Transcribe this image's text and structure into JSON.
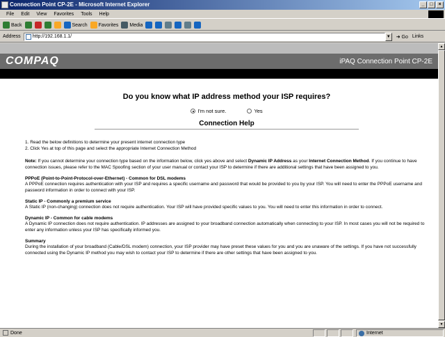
{
  "window": {
    "title": "Connection Point CP-2E - Microsoft Internet Explorer"
  },
  "menu": [
    "File",
    "Edit",
    "View",
    "Favorites",
    "Tools",
    "Help"
  ],
  "toolbar": {
    "back": "Back",
    "search": "Search",
    "favorites": "Favorites",
    "media": "Media"
  },
  "address": {
    "label": "Address",
    "url": "http://192.168.1.1/",
    "go": "Go",
    "links": "Links"
  },
  "banner": {
    "brand": "COMPAQ",
    "product": "iPAQ Connection Point CP-2E"
  },
  "page": {
    "question": "Do you know what IP address method your ISP requires?",
    "radio_not_sure": "I'm not sure.",
    "radio_yes": "Yes",
    "help_title": "Connection Help",
    "step1": "1. Read the below definitions to determine your present internet connection type",
    "step2": "2. Click Yes at top of this page and select the appropriate Internet Connection Method",
    "note_label": "Note:",
    "note_text1": " If you cannot determine your connection type based on the information below, click yes above and select ",
    "note_bold1": "Dynamic IP Address",
    "note_text2": " as your ",
    "note_bold2": "Internet Connection Method",
    "note_text3": ". If you continue to have connection issues, please refer to the MAC Spoofing section of your user manual or contact your ISP to determine if there are additional settings that have been assigned to you.",
    "pppoe_h": "PPPoE (Point-to-Point-Protocol-over-Ethernet) - Common for DSL modems",
    "pppoe_t": "A PPPoE connection requires authentication with your ISP and requires a specific username and password that would be provided to you by your ISP. You will need to enter the PPPoE username and password information in order to connect with your ISP.",
    "static_h": "Static IP - Commonly a premium service",
    "static_t": "A Static IP (non-changing) connection does not require authentication. Your ISP will have provided specific values to you. You will need to enter this information in order to connect.",
    "dynamic_h": "Dynamic IP - Common for cable modems",
    "dynamic_t": "A Dynamic IP connection does not require authentication. IP addresses are assigned to your broadband connection automatically when connecting to your ISP. In most cases you will not be required to enter any information unless your ISP has specifically informed you.",
    "summary_h": "Summary",
    "summary_t": "During the installation of your broadband (Cable/DSL modem) connection, your ISP provider may have preset these values for you and you are unaware of the settings. If you have not successfully connected using the Dynamic IP method you may wish to contact your ISP to determine if there are other settings that have been assigned to you."
  },
  "status": {
    "left": "Done",
    "zone": "Internet"
  },
  "colors": {
    "banner": "#6c6c6c",
    "title_start": "#0a246a"
  }
}
